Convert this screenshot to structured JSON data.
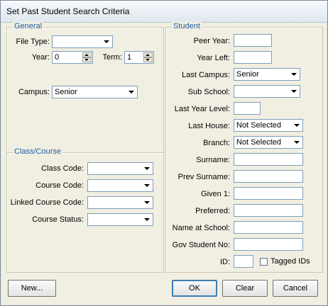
{
  "window": {
    "title": "Set Past Student Search Criteria"
  },
  "general": {
    "legend": "General",
    "file_type_label": "File Type:",
    "file_type_value": "",
    "year_label": "Year:",
    "year_value": "0",
    "term_label": "Term:",
    "term_value": "1",
    "campus_label": "Campus:",
    "campus_value": "Senior"
  },
  "class_course": {
    "legend": "Class/Course",
    "class_code_label": "Class Code:",
    "class_code_value": "",
    "course_code_label": "Course Code:",
    "course_code_value": "",
    "linked_course_code_label": "Linked Course Code:",
    "linked_course_code_value": "",
    "course_status_label": "Course Status:",
    "course_status_value": ""
  },
  "student": {
    "legend": "Student",
    "peer_year_label": "Peer Year:",
    "year_left_label": "Year Left:",
    "last_campus_label": "Last Campus:",
    "last_campus_value": "Senior",
    "sub_school_label": "Sub School:",
    "sub_school_value": "",
    "last_year_level_label": "Last Year Level:",
    "last_house_label": "Last House:",
    "last_house_value": "Not Selected",
    "branch_label": "Branch:",
    "branch_value": "Not Selected",
    "surname_label": "Surname:",
    "prev_surname_label": "Prev Surname:",
    "given1_label": "Given 1:",
    "preferred_label": "Preferred:",
    "name_at_school_label": "Name at School:",
    "gov_student_no_label": "Gov Student No:",
    "id_label": "ID:",
    "tagged_ids_label": "Tagged IDs"
  },
  "buttons": {
    "new_label": "New...",
    "ok_label": "OK",
    "clear_label": "Clear",
    "cancel_label": "Cancel"
  }
}
